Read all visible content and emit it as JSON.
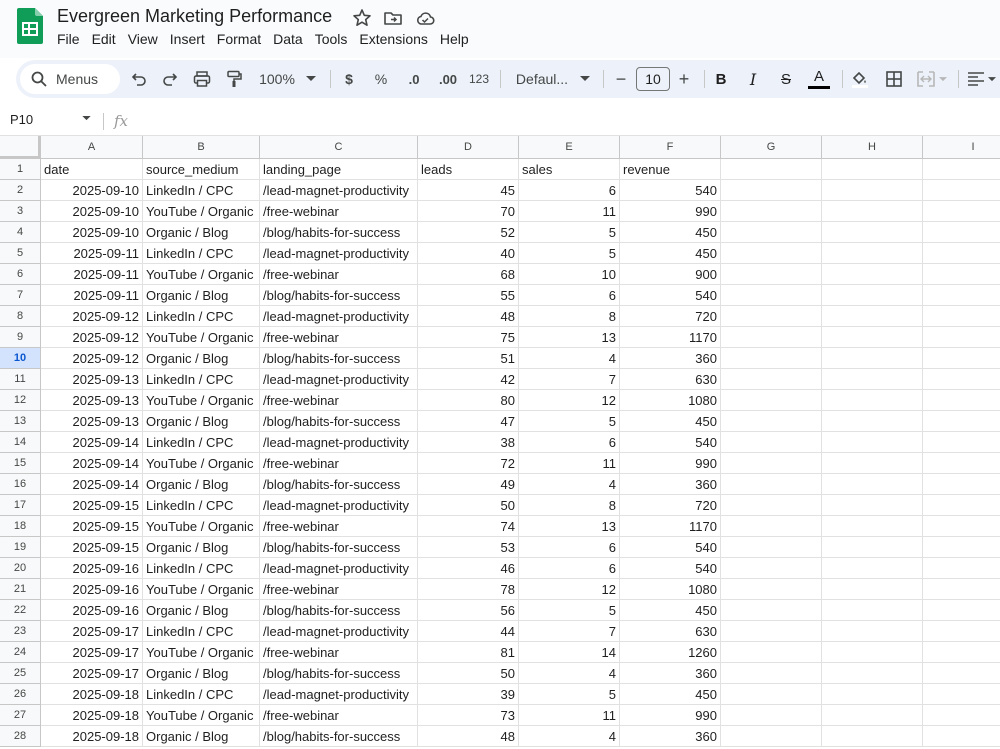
{
  "app": {
    "title": "Evergreen Marketing Performance",
    "menu": [
      "File",
      "Edit",
      "View",
      "Insert",
      "Format",
      "Data",
      "Tools",
      "Extensions",
      "Help"
    ]
  },
  "toolbar": {
    "menus_label": "Menus",
    "zoom": "100%",
    "currency": "$",
    "percent": "%",
    "decrease_decimal": ".0",
    "increase_decimal": ".00",
    "number_format": "123",
    "font": "Defaul...",
    "font_size": "10",
    "minus": "−",
    "plus": "+",
    "bold": "B",
    "italic": "I",
    "strike": "S",
    "text_color": "A"
  },
  "formula_bar": {
    "cell_ref": "P10",
    "fx": "fx",
    "content": ""
  },
  "sheet": {
    "columns": [
      "A",
      "B",
      "C",
      "D",
      "E",
      "F",
      "G",
      "H",
      "I"
    ],
    "selected_row": 10,
    "headers": [
      "date",
      "source_medium",
      "landing_page",
      "leads",
      "sales",
      "revenue"
    ],
    "rows": [
      [
        "2025-09-10",
        "LinkedIn / CPC",
        "/lead-magnet-productivity",
        "45",
        "6",
        "540"
      ],
      [
        "2025-09-10",
        "YouTube / Organic",
        "/free-webinar",
        "70",
        "11",
        "990"
      ],
      [
        "2025-09-10",
        "Organic / Blog",
        "/blog/habits-for-success",
        "52",
        "5",
        "450"
      ],
      [
        "2025-09-11",
        "LinkedIn / CPC",
        "/lead-magnet-productivity",
        "40",
        "5",
        "450"
      ],
      [
        "2025-09-11",
        "YouTube / Organic",
        "/free-webinar",
        "68",
        "10",
        "900"
      ],
      [
        "2025-09-11",
        "Organic / Blog",
        "/blog/habits-for-success",
        "55",
        "6",
        "540"
      ],
      [
        "2025-09-12",
        "LinkedIn / CPC",
        "/lead-magnet-productivity",
        "48",
        "8",
        "720"
      ],
      [
        "2025-09-12",
        "YouTube / Organic",
        "/free-webinar",
        "75",
        "13",
        "1170"
      ],
      [
        "2025-09-12",
        "Organic / Blog",
        "/blog/habits-for-success",
        "51",
        "4",
        "360"
      ],
      [
        "2025-09-13",
        "LinkedIn / CPC",
        "/lead-magnet-productivity",
        "42",
        "7",
        "630"
      ],
      [
        "2025-09-13",
        "YouTube / Organic",
        "/free-webinar",
        "80",
        "12",
        "1080"
      ],
      [
        "2025-09-13",
        "Organic / Blog",
        "/blog/habits-for-success",
        "47",
        "5",
        "450"
      ],
      [
        "2025-09-14",
        "LinkedIn / CPC",
        "/lead-magnet-productivity",
        "38",
        "6",
        "540"
      ],
      [
        "2025-09-14",
        "YouTube / Organic",
        "/free-webinar",
        "72",
        "11",
        "990"
      ],
      [
        "2025-09-14",
        "Organic / Blog",
        "/blog/habits-for-success",
        "49",
        "4",
        "360"
      ],
      [
        "2025-09-15",
        "LinkedIn / CPC",
        "/lead-magnet-productivity",
        "50",
        "8",
        "720"
      ],
      [
        "2025-09-15",
        "YouTube / Organic",
        "/free-webinar",
        "74",
        "13",
        "1170"
      ],
      [
        "2025-09-15",
        "Organic / Blog",
        "/blog/habits-for-success",
        "53",
        "6",
        "540"
      ],
      [
        "2025-09-16",
        "LinkedIn / CPC",
        "/lead-magnet-productivity",
        "46",
        "6",
        "540"
      ],
      [
        "2025-09-16",
        "YouTube / Organic",
        "/free-webinar",
        "78",
        "12",
        "1080"
      ],
      [
        "2025-09-16",
        "Organic / Blog",
        "/blog/habits-for-success",
        "56",
        "5",
        "450"
      ],
      [
        "2025-09-17",
        "LinkedIn / CPC",
        "/lead-magnet-productivity",
        "44",
        "7",
        "630"
      ],
      [
        "2025-09-17",
        "YouTube / Organic",
        "/free-webinar",
        "81",
        "14",
        "1260"
      ],
      [
        "2025-09-17",
        "Organic / Blog",
        "/blog/habits-for-success",
        "50",
        "4",
        "360"
      ],
      [
        "2025-09-18",
        "LinkedIn / CPC",
        "/lead-magnet-productivity",
        "39",
        "5",
        "450"
      ],
      [
        "2025-09-18",
        "YouTube / Organic",
        "/free-webinar",
        "73",
        "11",
        "990"
      ],
      [
        "2025-09-18",
        "Organic / Blog",
        "/blog/habits-for-success",
        "48",
        "4",
        "360"
      ]
    ]
  },
  "colors": {
    "logo": "#0f9d58",
    "toolbar_bg": "#edf2fa",
    "selected_row_bg": "#d3e3fd",
    "selected_row_text": "#0b57d0"
  },
  "icons": [
    "sheets-logo-icon",
    "star-icon",
    "move-folder-icon",
    "cloud-status-icon",
    "search-icon",
    "undo-icon",
    "redo-icon",
    "print-icon",
    "paint-format-icon",
    "dropdown-arrow-icon",
    "fill-color-icon",
    "borders-icon",
    "merge-cells-icon",
    "align-left-icon"
  ]
}
